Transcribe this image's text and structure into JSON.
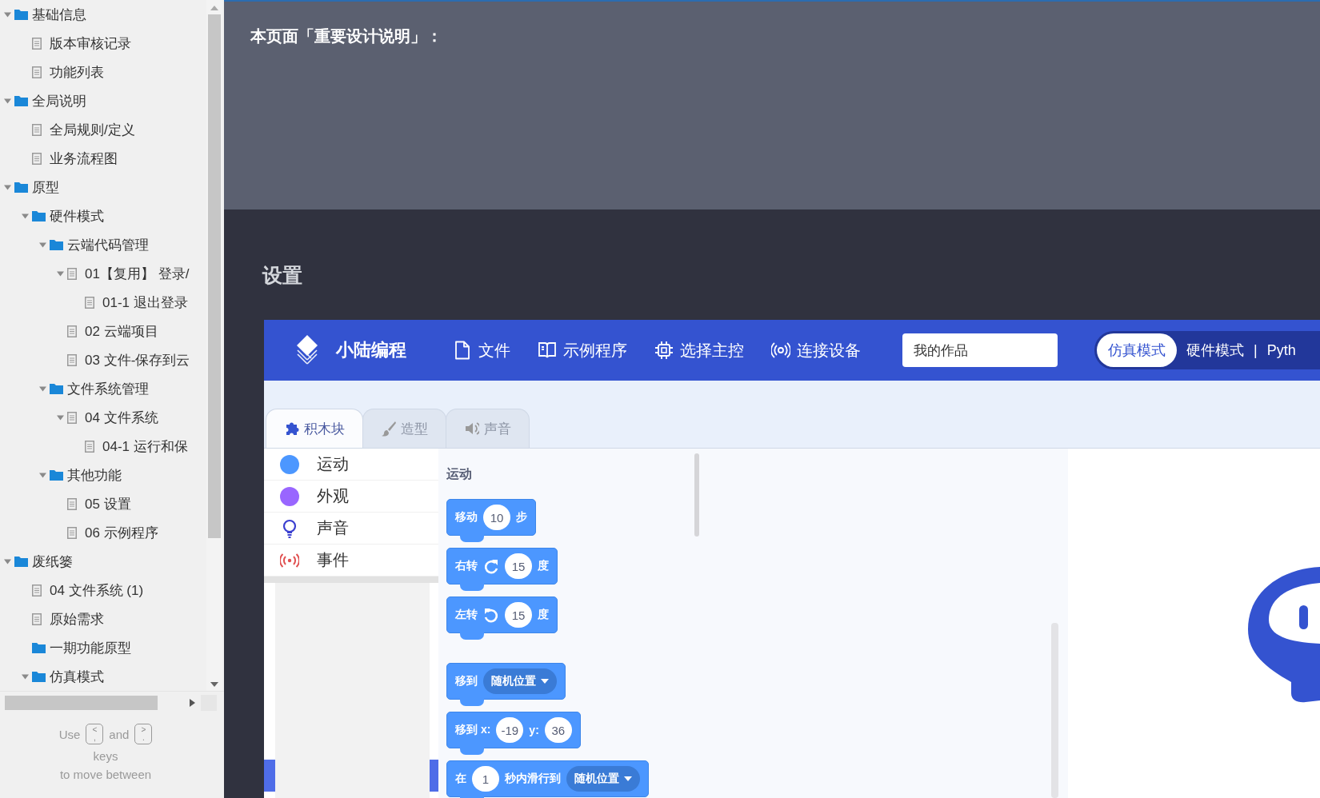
{
  "sidebar": {
    "tree": [
      {
        "label": "基础信息",
        "kind": "folder",
        "expanded": true,
        "children": [
          {
            "label": "版本审核记录",
            "kind": "page"
          },
          {
            "label": "功能列表",
            "kind": "page"
          }
        ]
      },
      {
        "label": "全局说明",
        "kind": "folder",
        "expanded": true,
        "children": [
          {
            "label": "全局规则/定义",
            "kind": "page"
          },
          {
            "label": "业务流程图",
            "kind": "page"
          }
        ]
      },
      {
        "label": "原型",
        "kind": "folder",
        "expanded": true,
        "children": [
          {
            "label": "硬件模式",
            "kind": "folder",
            "expanded": true,
            "children": [
              {
                "label": "云端代码管理",
                "kind": "folder",
                "expanded": true,
                "children": [
                  {
                    "label": "01【复用】 登录/",
                    "kind": "page",
                    "expanded": true,
                    "children": [
                      {
                        "label": "01-1 退出登录",
                        "kind": "page"
                      }
                    ]
                  },
                  {
                    "label": "02 云端项目",
                    "kind": "page"
                  },
                  {
                    "label": "03 文件-保存到云",
                    "kind": "page"
                  }
                ]
              },
              {
                "label": "文件系统管理",
                "kind": "folder",
                "expanded": true,
                "children": [
                  {
                    "label": "04 文件系统",
                    "kind": "page",
                    "expanded": true,
                    "children": [
                      {
                        "label": "04-1 运行和保",
                        "kind": "page"
                      }
                    ]
                  }
                ]
              },
              {
                "label": "其他功能",
                "kind": "folder",
                "expanded": true,
                "children": [
                  {
                    "label": "05 设置",
                    "kind": "page"
                  },
                  {
                    "label": "06 示例程序",
                    "kind": "page"
                  }
                ]
              }
            ]
          }
        ]
      },
      {
        "label": "废纸篓",
        "kind": "folder",
        "expanded": true,
        "children": [
          {
            "label": "04 文件系统 (1)",
            "kind": "page"
          },
          {
            "label": "原始需求",
            "kind": "page"
          },
          {
            "label": "一期功能原型",
            "kind": "folder"
          },
          {
            "label": "仿真模式",
            "kind": "folder",
            "expanded": true
          }
        ]
      }
    ],
    "key_hint": {
      "word_1": "Use",
      "key_1": {
        "top": "<",
        "bottom": ","
      },
      "word_2": "and",
      "key_2": {
        "top": ">",
        "bottom": "."
      },
      "word_3": "keys",
      "line_2": "to move between"
    }
  },
  "notes": {
    "title": "本页面「重要设计说明」："
  },
  "section_title": "设置",
  "app": {
    "brand": "小陆编程",
    "menu": [
      {
        "label": "文件",
        "kind": "file"
      },
      {
        "label": "示例程序",
        "kind": "book"
      },
      {
        "label": "选择主控",
        "kind": "chip"
      },
      {
        "label": "连接设备",
        "kind": "signal"
      }
    ],
    "search": {
      "value": "我的作品"
    },
    "modes": [
      {
        "label": "仿真模式",
        "selected": true
      },
      {
        "label": "硬件模式",
        "selected": false
      },
      {
        "label": "Pyth",
        "selected": false
      }
    ],
    "mode_separator": "|",
    "tabs": [
      {
        "label": "积木块",
        "kind": "puzzle",
        "selected": true
      },
      {
        "label": "造型",
        "kind": "brush",
        "selected": false
      },
      {
        "label": "声音",
        "kind": "speaker",
        "selected": false
      }
    ],
    "categories": [
      {
        "label": "运动",
        "kind": "dot",
        "color": "#4c97ff"
      },
      {
        "label": "外观",
        "kind": "dot",
        "color": "#9966ff"
      },
      {
        "label": "声音",
        "kind": "bulb",
        "color": "#3a3fd0"
      },
      {
        "label": "事件",
        "kind": "signal",
        "color": "#e05050"
      }
    ],
    "palette": {
      "heading": "运动",
      "groups": [
        [
          {
            "parts": [
              {
                "kind": "text",
                "text": "移动"
              },
              {
                "kind": "input",
                "text": "10"
              },
              {
                "kind": "text",
                "text": "步"
              }
            ]
          },
          {
            "parts": [
              {
                "kind": "text",
                "text": "右转"
              },
              {
                "kind": "rotate_right"
              },
              {
                "kind": "input",
                "text": "15"
              },
              {
                "kind": "text",
                "text": "度"
              }
            ]
          },
          {
            "parts": [
              {
                "kind": "text",
                "text": "左转"
              },
              {
                "kind": "rotate_left"
              },
              {
                "kind": "input",
                "text": "15"
              },
              {
                "kind": "text",
                "text": "度"
              }
            ]
          }
        ],
        [
          {
            "parts": [
              {
                "kind": "text",
                "text": "移到"
              },
              {
                "kind": "dropdown",
                "text": "随机位置"
              }
            ]
          },
          {
            "parts": [
              {
                "kind": "text",
                "text": "移到 x:"
              },
              {
                "kind": "input",
                "text": "-19"
              },
              {
                "kind": "text",
                "text": "y:"
              },
              {
                "kind": "input",
                "text": "36"
              }
            ]
          },
          {
            "parts": [
              {
                "kind": "text",
                "text": "在"
              },
              {
                "kind": "input",
                "text": "1"
              },
              {
                "kind": "text",
                "text": "秒内滑行到"
              },
              {
                "kind": "dropdown",
                "text": "随机位置"
              }
            ]
          }
        ]
      ]
    }
  }
}
